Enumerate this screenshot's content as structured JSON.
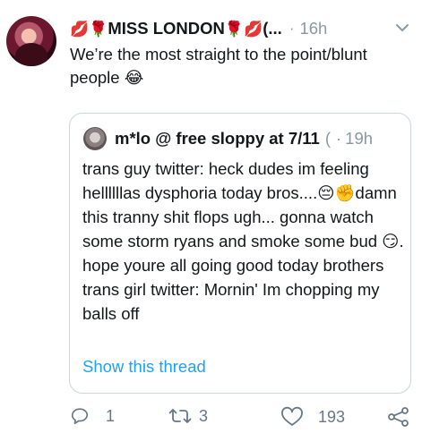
{
  "tweet": {
    "display_name": "MISS LONDON",
    "name_prefix_emoji": "💋🌹",
    "name_suffix_emoji": "🌹💋",
    "name_overflow": "(...",
    "separator": "·",
    "time": "16h",
    "text": "We’re the most straight to the point/blunt people 😂"
  },
  "quote": {
    "display_name": "m*lo @ free sloppy at 7/11",
    "handle_truncated": "(",
    "separator": "·",
    "time": "19h",
    "text_parts": {
      "a": "trans guy twitter: heck dudes im feeling hellllllas dysphoria today bros....",
      "b": "😔✊",
      "c": "damn this tranny shit flops ugh... gonna watch some storm ryans and smoke some bud ",
      "d": "😏",
      "e": ". hope youre all going good today brothers trans girl twitter: Mornin' Im chopping my balls off"
    },
    "show_thread": "Show this thread"
  },
  "actions": {
    "reply_count": "1",
    "retweet_count": "3",
    "like_count": "193"
  },
  "icons": {
    "reply": "reply-icon",
    "retweet": "retweet-icon",
    "like": "heart-icon",
    "share": "share-icon",
    "more": "chevron-down-icon"
  },
  "colors": {
    "link": "#1da1f2",
    "secondary": "#8899a6",
    "border": "#ccd6dd"
  }
}
